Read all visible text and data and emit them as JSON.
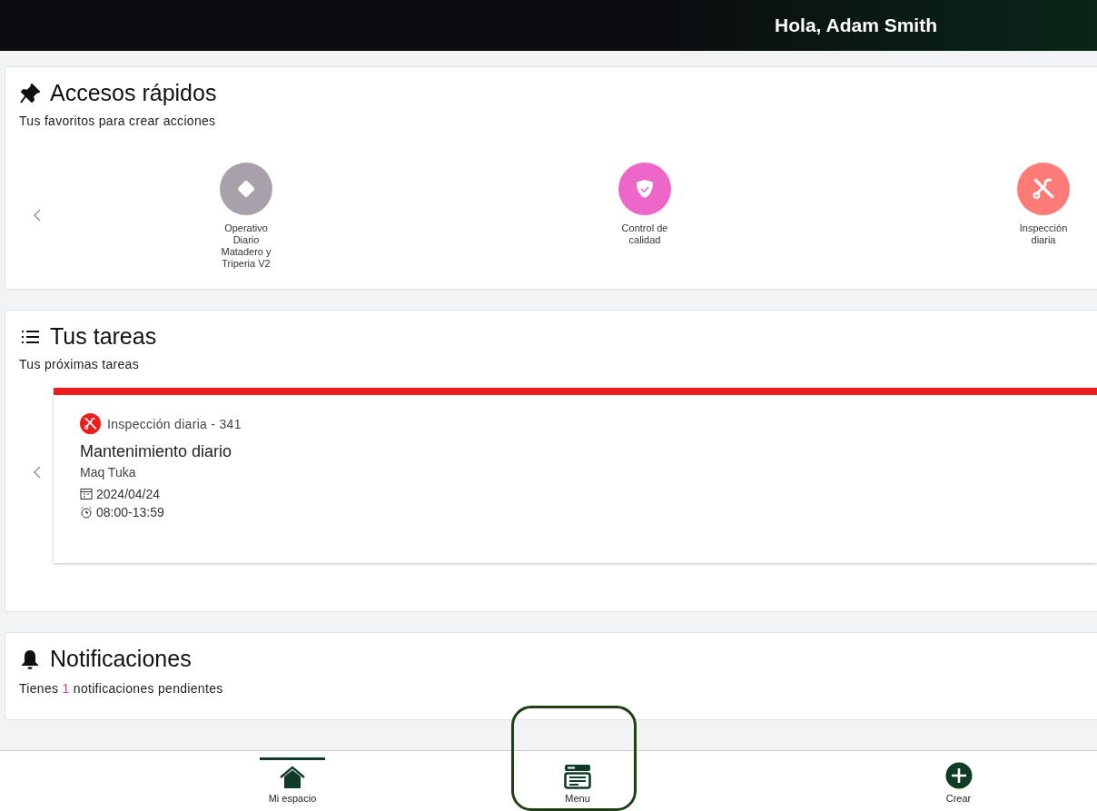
{
  "header": {
    "greeting": "Hola, Adam Smith"
  },
  "quick_access": {
    "title": "Accesos rápidos",
    "subtitle": "Tus favoritos para crear acciones",
    "items": [
      {
        "label": "Operativo Diario Matadero y Triperia V2",
        "color": "#a8a1ab",
        "kind": "diamond"
      },
      {
        "label": "Control de calidad",
        "color": "#ec67c8",
        "kind": "shield"
      },
      {
        "label": "Inspección diaria",
        "color": "#ff7b78",
        "kind": "tools"
      }
    ]
  },
  "tasks": {
    "title": "Tus tareas",
    "subtitle": "Tus próximas tareas",
    "items": [
      {
        "type": "Inspección diaria - 341",
        "title": "Mantenimiento diario",
        "asset": "Maq Tuka",
        "date": "2024/04/24",
        "time": "08:00-13:59",
        "color": "#ee1c1c"
      }
    ]
  },
  "notifications": {
    "title": "Notificaciones",
    "before": "Tienes",
    "count": "1",
    "after": "notificaciones pendientes"
  },
  "bottom_nav": [
    {
      "label": "Mi espacio",
      "kind": "home",
      "selected": true
    },
    {
      "label": "Menu",
      "kind": "menu",
      "selected": false,
      "highlighted": true
    },
    {
      "label": "Crear",
      "kind": "plus",
      "selected": false
    }
  ]
}
